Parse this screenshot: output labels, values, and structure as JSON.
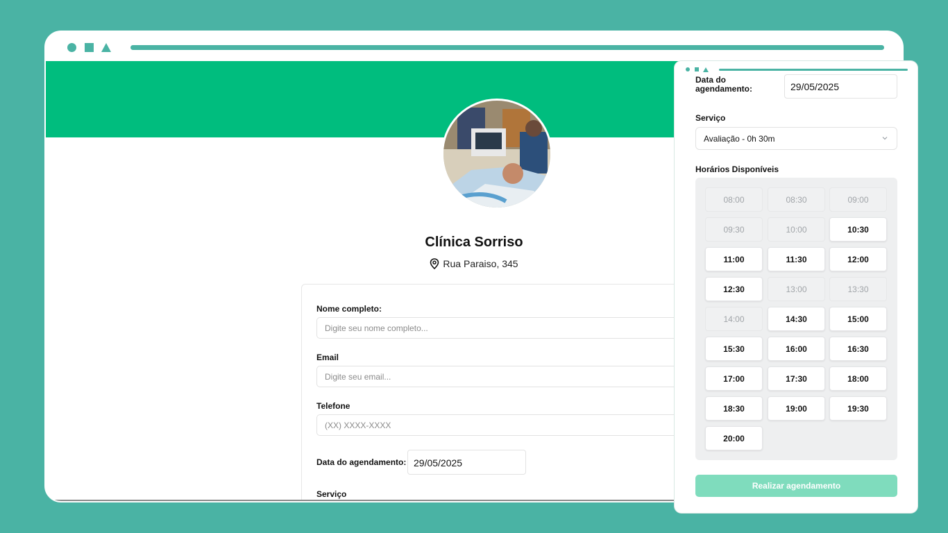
{
  "colors": {
    "background": "#4ab3a4",
    "brand_green": "#00bd7e",
    "button_disabled": "#7fdcbd"
  },
  "clinic": {
    "name": "Clínica Sorriso",
    "address": "Rua Paraiso, 345"
  },
  "form": {
    "name_label": "Nome completo:",
    "name_placeholder": "Digite seu nome completo...",
    "email_label": "Email",
    "email_placeholder": "Digite seu email...",
    "phone_label": "Telefone",
    "phone_placeholder": "(XX) XXXX-XXXX",
    "date_label": "Data do agendamento:",
    "date_value": "29/05/2025",
    "service_label": "Serviço"
  },
  "panel": {
    "date_label": "Data do agendamento:",
    "date_value": "29/05/2025",
    "service_label": "Serviço",
    "service_value": "Avaliação - 0h 30m",
    "slots_label": "Horários Disponíveis",
    "slots": [
      {
        "time": "08:00",
        "available": false
      },
      {
        "time": "08:30",
        "available": false
      },
      {
        "time": "09:00",
        "available": false
      },
      {
        "time": "09:30",
        "available": false
      },
      {
        "time": "10:00",
        "available": false
      },
      {
        "time": "10:30",
        "available": true
      },
      {
        "time": "11:00",
        "available": true
      },
      {
        "time": "11:30",
        "available": true
      },
      {
        "time": "12:00",
        "available": true
      },
      {
        "time": "12:30",
        "available": true
      },
      {
        "time": "13:00",
        "available": false
      },
      {
        "time": "13:30",
        "available": false
      },
      {
        "time": "14:00",
        "available": false
      },
      {
        "time": "14:30",
        "available": true
      },
      {
        "time": "15:00",
        "available": true
      },
      {
        "time": "15:30",
        "available": true
      },
      {
        "time": "16:00",
        "available": true
      },
      {
        "time": "16:30",
        "available": true
      },
      {
        "time": "17:00",
        "available": true
      },
      {
        "time": "17:30",
        "available": true
      },
      {
        "time": "18:00",
        "available": true
      },
      {
        "time": "18:30",
        "available": true
      },
      {
        "time": "19:00",
        "available": true
      },
      {
        "time": "19:30",
        "available": true
      },
      {
        "time": "20:00",
        "available": true
      }
    ],
    "submit_label": "Realizar agendamento"
  }
}
